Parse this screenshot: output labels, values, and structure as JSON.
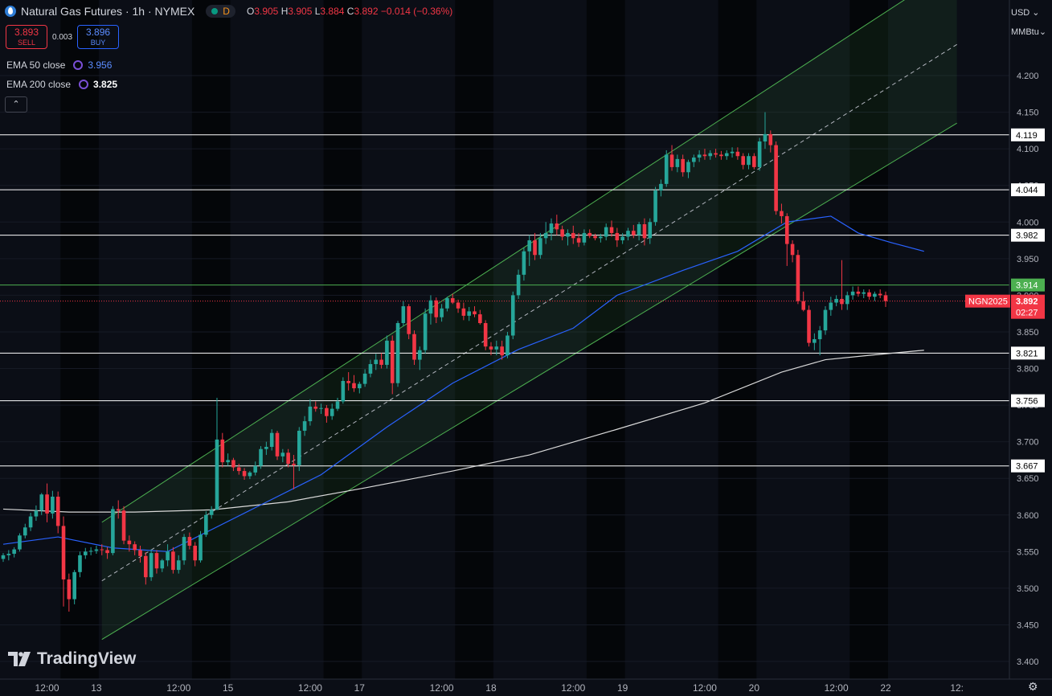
{
  "header": {
    "title": "Natural Gas Futures · 1h · NYMEX",
    "session_letter": "D",
    "ohlc": {
      "o_label": "O",
      "o": "3.905",
      "h_label": "H",
      "h": "3.905",
      "l_label": "L",
      "l": "3.884",
      "c_label": "C",
      "c": "3.892",
      "change": "−0.014 (−0.36%)"
    }
  },
  "trade": {
    "sell_price": "3.893",
    "sell_label": "SELL",
    "spread": "0.003",
    "buy_price": "3.896",
    "buy_label": "BUY"
  },
  "indicators": [
    {
      "label": "EMA 50 close",
      "value": "3.956",
      "color": "#5b8cff"
    },
    {
      "label": "EMA 200 close",
      "value": "3.825",
      "color": "#ffffff"
    }
  ],
  "collapse_icon": "chevron-up-icon",
  "currency": "USD",
  "unit": "MMBtu",
  "watermark": "TradingView",
  "colors": {
    "up": "#26a69a",
    "down": "#f23645",
    "ema50": "#2962ff",
    "ema200": "#d9d9d9",
    "channel": "#4caf50",
    "price_line": "#f23645"
  },
  "chart_data": {
    "type": "candlestick",
    "ylim": [
      3.4,
      4.26
    ],
    "y_ticks": [
      "3.400",
      "3.450",
      "3.500",
      "3.550",
      "3.600",
      "3.650",
      "3.700",
      "3.750",
      "3.800",
      "3.850",
      "3.900",
      "3.950",
      "4.000",
      "4.050",
      "4.100",
      "4.150",
      "4.200"
    ],
    "x_ticks": [
      {
        "i": 8,
        "label": "12:00"
      },
      {
        "i": 17,
        "label": "13"
      },
      {
        "i": 32,
        "label": "12:00"
      },
      {
        "i": 41,
        "label": "15"
      },
      {
        "i": 56,
        "label": "12:00"
      },
      {
        "i": 65,
        "label": "17"
      },
      {
        "i": 80,
        "label": "12:00"
      },
      {
        "i": 89,
        "label": "18"
      },
      {
        "i": 104,
        "label": "12:00"
      },
      {
        "i": 113,
        "label": "19"
      },
      {
        "i": 128,
        "label": "12:00"
      },
      {
        "i": 137,
        "label": "20"
      },
      {
        "i": 152,
        "label": "12:00"
      },
      {
        "i": 161,
        "label": "22"
      },
      {
        "i": 174,
        "label": "12:"
      }
    ],
    "horizontal_levels": [
      {
        "value": 4.119,
        "label": "4.119",
        "color": "#ffffff"
      },
      {
        "value": 4.044,
        "label": "4.044",
        "color": "#ffffff"
      },
      {
        "value": 3.982,
        "label": "3.982",
        "color": "#ffffff"
      },
      {
        "value": 3.914,
        "label": "3.914",
        "color": "#4caf50"
      },
      {
        "value": 3.821,
        "label": "3.821",
        "color": "#ffffff"
      },
      {
        "value": 3.756,
        "label": "3.756",
        "color": "#ffffff"
      },
      {
        "value": 3.667,
        "label": "3.667",
        "color": "#ffffff"
      }
    ],
    "last_price": {
      "value": 3.892,
      "label": "3.892",
      "countdown": "02:27",
      "symbol": "NGN2025"
    },
    "channel": {
      "start_i": 18,
      "end_i": 174,
      "lower_start": 3.43,
      "lower_end": 4.135,
      "upper_start": 3.59,
      "upper_end": 4.35
    },
    "ema50": {
      "x": [
        0,
        10,
        20,
        30,
        38,
        46,
        58,
        70,
        82,
        94,
        104,
        112,
        124,
        134,
        143,
        151,
        156,
        162,
        168
      ],
      "y": [
        3.56,
        3.57,
        3.555,
        3.55,
        3.58,
        3.61,
        3.655,
        3.72,
        3.78,
        3.826,
        3.855,
        3.9,
        3.934,
        3.96,
        4.0,
        4.008,
        3.985,
        3.972,
        3.96
      ]
    },
    "ema200": {
      "x": [
        0,
        12,
        24,
        38,
        52,
        66,
        82,
        96,
        112,
        128,
        142,
        150,
        158,
        168
      ],
      "y": [
        3.608,
        3.604,
        3.604,
        3.607,
        3.618,
        3.637,
        3.66,
        3.682,
        3.717,
        3.753,
        3.795,
        3.812,
        3.818,
        3.825
      ]
    },
    "candles": [
      [
        3.54,
        3.548,
        3.536,
        3.545
      ],
      [
        3.545,
        3.552,
        3.538,
        3.547
      ],
      [
        3.547,
        3.556,
        3.542,
        3.553
      ],
      [
        3.553,
        3.575,
        3.55,
        3.572
      ],
      [
        3.572,
        3.588,
        3.568,
        3.583
      ],
      [
        3.583,
        3.603,
        3.578,
        3.598
      ],
      [
        3.598,
        3.613,
        3.592,
        3.606
      ],
      [
        3.606,
        3.63,
        3.6,
        3.628
      ],
      [
        3.628,
        3.643,
        3.59,
        3.602
      ],
      [
        3.602,
        3.633,
        3.595,
        3.625
      ],
      [
        3.625,
        3.632,
        3.575,
        3.585
      ],
      [
        3.585,
        3.598,
        3.475,
        3.512
      ],
      [
        3.512,
        3.52,
        3.468,
        3.485
      ],
      [
        3.485,
        3.525,
        3.478,
        3.522
      ],
      [
        3.522,
        3.55,
        3.515,
        3.545
      ],
      [
        3.545,
        3.555,
        3.54,
        3.55
      ],
      [
        3.55,
        3.556,
        3.545,
        3.551
      ],
      [
        3.551,
        3.558,
        3.547,
        3.553
      ],
      [
        3.553,
        3.56,
        3.545,
        3.552
      ],
      [
        3.552,
        3.556,
        3.54,
        3.548
      ],
      [
        3.548,
        3.612,
        3.545,
        3.608
      ],
      [
        3.608,
        3.62,
        3.595,
        3.606
      ],
      [
        3.606,
        3.612,
        3.56,
        3.565
      ],
      [
        3.565,
        3.572,
        3.55,
        3.56
      ],
      [
        3.56,
        3.564,
        3.545,
        3.552
      ],
      [
        3.552,
        3.558,
        3.535,
        3.544
      ],
      [
        3.544,
        3.549,
        3.505,
        3.515
      ],
      [
        3.515,
        3.553,
        3.51,
        3.548
      ],
      [
        3.548,
        3.552,
        3.52,
        3.527
      ],
      [
        3.527,
        3.54,
        3.522,
        3.538
      ],
      [
        3.538,
        3.56,
        3.53,
        3.55
      ],
      [
        3.55,
        3.556,
        3.52,
        3.525
      ],
      [
        3.525,
        3.545,
        3.52,
        3.538
      ],
      [
        3.538,
        3.574,
        3.532,
        3.57
      ],
      [
        3.57,
        3.576,
        3.553,
        3.558
      ],
      [
        3.558,
        3.563,
        3.53,
        3.538
      ],
      [
        3.538,
        3.578,
        3.535,
        3.573
      ],
      [
        3.573,
        3.605,
        3.57,
        3.6
      ],
      [
        3.6,
        3.612,
        3.595,
        3.607
      ],
      [
        3.607,
        3.76,
        3.66,
        3.703
      ],
      [
        3.703,
        3.712,
        3.665,
        3.672
      ],
      [
        3.672,
        3.684,
        3.667,
        3.675
      ],
      [
        3.675,
        3.678,
        3.66,
        3.665
      ],
      [
        3.665,
        3.67,
        3.655,
        3.66
      ],
      [
        3.66,
        3.664,
        3.648,
        3.653
      ],
      [
        3.653,
        3.66,
        3.649,
        3.658
      ],
      [
        3.658,
        3.673,
        3.654,
        3.667
      ],
      [
        3.667,
        3.694,
        3.663,
        3.69
      ],
      [
        3.69,
        3.7,
        3.682,
        3.693
      ],
      [
        3.693,
        3.717,
        3.688,
        3.712
      ],
      [
        3.712,
        3.715,
        3.675,
        3.68
      ],
      [
        3.68,
        3.69,
        3.672,
        3.685
      ],
      [
        3.685,
        3.69,
        3.665,
        3.67
      ],
      [
        3.67,
        3.682,
        3.635,
        3.668
      ],
      [
        3.668,
        3.72,
        3.66,
        3.715
      ],
      [
        3.715,
        3.735,
        3.708,
        3.728
      ],
      [
        3.728,
        3.758,
        3.722,
        3.748
      ],
      [
        3.748,
        3.755,
        3.741,
        3.745
      ],
      [
        3.745,
        3.752,
        3.738,
        3.746
      ],
      [
        3.746,
        3.75,
        3.726,
        3.735
      ],
      [
        3.735,
        3.752,
        3.73,
        3.745
      ],
      [
        3.745,
        3.76,
        3.742,
        3.755
      ],
      [
        3.755,
        3.788,
        3.752,
        3.783
      ],
      [
        3.783,
        3.795,
        3.77,
        3.78
      ],
      [
        3.78,
        3.791,
        3.768,
        3.773
      ],
      [
        3.773,
        3.782,
        3.766,
        3.779
      ],
      [
        3.779,
        3.799,
        3.775,
        3.793
      ],
      [
        3.793,
        3.812,
        3.788,
        3.806
      ],
      [
        3.806,
        3.82,
        3.798,
        3.812
      ],
      [
        3.812,
        3.821,
        3.8,
        3.805
      ],
      [
        3.805,
        3.845,
        3.8,
        3.838
      ],
      [
        3.838,
        3.845,
        3.765,
        3.78
      ],
      [
        3.78,
        3.865,
        3.775,
        3.862
      ],
      [
        3.862,
        3.892,
        3.858,
        3.885
      ],
      [
        3.885,
        3.888,
        3.84,
        3.847
      ],
      [
        3.847,
        3.852,
        3.805,
        3.812
      ],
      [
        3.812,
        3.83,
        3.798,
        3.825
      ],
      [
        3.825,
        3.882,
        3.82,
        3.875
      ],
      [
        3.875,
        3.9,
        3.86,
        3.893
      ],
      [
        3.893,
        3.897,
        3.862,
        3.87
      ],
      [
        3.87,
        3.888,
        3.864,
        3.882
      ],
      [
        3.882,
        3.898,
        3.878,
        3.896
      ],
      [
        3.896,
        3.902,
        3.888,
        3.89
      ],
      [
        3.89,
        3.894,
        3.876,
        3.882
      ],
      [
        3.882,
        3.89,
        3.866,
        3.872
      ],
      [
        3.872,
        3.884,
        3.865,
        3.878
      ],
      [
        3.878,
        3.885,
        3.87,
        3.874
      ],
      [
        3.874,
        3.88,
        3.86,
        3.862
      ],
      [
        3.862,
        3.866,
        3.825,
        3.83
      ],
      [
        3.83,
        3.836,
        3.818,
        3.826
      ],
      [
        3.826,
        3.838,
        3.818,
        3.83
      ],
      [
        3.83,
        3.838,
        3.812,
        3.818
      ],
      [
        3.818,
        3.85,
        3.814,
        3.845
      ],
      [
        3.845,
        3.905,
        3.84,
        3.9
      ],
      [
        3.9,
        3.935,
        3.895,
        3.928
      ],
      [
        3.928,
        3.965,
        3.92,
        3.96
      ],
      [
        3.96,
        3.982,
        3.94,
        3.975
      ],
      [
        3.975,
        3.985,
        3.948,
        3.955
      ],
      [
        3.955,
        3.985,
        3.95,
        3.978
      ],
      [
        3.978,
        4.0,
        3.97,
        3.985
      ],
      [
        3.985,
        4.005,
        3.975,
        3.998
      ],
      [
        3.998,
        4.01,
        3.982,
        3.99
      ],
      [
        3.99,
        3.995,
        3.975,
        3.98
      ],
      [
        3.98,
        3.99,
        3.968,
        3.985
      ],
      [
        3.985,
        3.995,
        3.97,
        3.978
      ],
      [
        3.978,
        3.985,
        3.966,
        3.972
      ],
      [
        3.972,
        3.99,
        3.968,
        3.985
      ],
      [
        3.985,
        3.99,
        3.978,
        3.981
      ],
      [
        3.981,
        3.984,
        3.975,
        3.978
      ],
      [
        3.978,
        3.984,
        3.972,
        3.98
      ],
      [
        3.98,
        3.998,
        3.975,
        3.993
      ],
      [
        3.993,
        4.002,
        3.98,
        3.985
      ],
      [
        3.985,
        3.992,
        3.966,
        3.975
      ],
      [
        3.975,
        3.985,
        3.97,
        3.98
      ],
      [
        3.98,
        3.992,
        3.975,
        3.988
      ],
      [
        3.988,
        3.996,
        3.978,
        3.982
      ],
      [
        3.982,
        4.0,
        3.975,
        3.997
      ],
      [
        3.997,
        4.005,
        3.968,
        3.978
      ],
      [
        3.978,
        4.005,
        3.97,
        4.0
      ],
      [
        4.0,
        4.048,
        3.995,
        4.043
      ],
      [
        4.043,
        4.058,
        4.035,
        4.052
      ],
      [
        4.052,
        4.098,
        4.048,
        4.092
      ],
      [
        4.092,
        4.105,
        4.07,
        4.075
      ],
      [
        4.075,
        4.092,
        4.068,
        4.086
      ],
      [
        4.086,
        4.092,
        4.062,
        4.068
      ],
      [
        4.068,
        4.085,
        4.06,
        4.082
      ],
      [
        4.082,
        4.092,
        4.075,
        4.088
      ],
      [
        4.088,
        4.098,
        4.082,
        4.092
      ],
      [
        4.092,
        4.1,
        4.085,
        4.09
      ],
      [
        4.09,
        4.098,
        4.085,
        4.094
      ],
      [
        4.094,
        4.1,
        4.088,
        4.092
      ],
      [
        4.092,
        4.097,
        4.085,
        4.09
      ],
      [
        4.09,
        4.098,
        4.085,
        4.094
      ],
      [
        4.094,
        4.102,
        4.088,
        4.096
      ],
      [
        4.096,
        4.102,
        4.085,
        4.09
      ],
      [
        4.09,
        4.094,
        4.072,
        4.078
      ],
      [
        4.078,
        4.094,
        4.072,
        4.09
      ],
      [
        4.09,
        4.094,
        4.072,
        4.075
      ],
      [
        4.075,
        4.115,
        4.07,
        4.11
      ],
      [
        4.11,
        4.15,
        4.1,
        4.12
      ],
      [
        4.12,
        4.125,
        4.095,
        4.105
      ],
      [
        4.105,
        4.11,
        4.01,
        4.015
      ],
      [
        4.015,
        4.025,
        3.998,
        4.008
      ],
      [
        4.008,
        4.012,
        3.94,
        3.97
      ],
      [
        3.97,
        3.975,
        3.945,
        3.955
      ],
      [
        3.955,
        3.962,
        3.888,
        3.892
      ],
      [
        3.892,
        3.905,
        3.878,
        3.88
      ],
      [
        3.88,
        3.886,
        3.83,
        3.835
      ],
      [
        3.835,
        3.848,
        3.825,
        3.84
      ],
      [
        3.84,
        3.858,
        3.818,
        3.852
      ],
      [
        3.852,
        3.885,
        3.846,
        3.88
      ],
      [
        3.88,
        3.898,
        3.872,
        3.89
      ],
      [
        3.89,
        3.9,
        3.885,
        3.895
      ],
      [
        3.895,
        3.948,
        3.88,
        3.888
      ],
      [
        3.888,
        3.905,
        3.88,
        3.9
      ],
      [
        3.9,
        3.912,
        3.894,
        3.905
      ],
      [
        3.905,
        3.912,
        3.898,
        3.902
      ],
      [
        3.902,
        3.908,
        3.896,
        3.904
      ],
      [
        3.904,
        3.908,
        3.894,
        3.898
      ],
      [
        3.898,
        3.905,
        3.892,
        3.902
      ],
      [
        3.902,
        3.908,
        3.896,
        3.9
      ],
      [
        3.9,
        3.905,
        3.884,
        3.892
      ]
    ]
  }
}
